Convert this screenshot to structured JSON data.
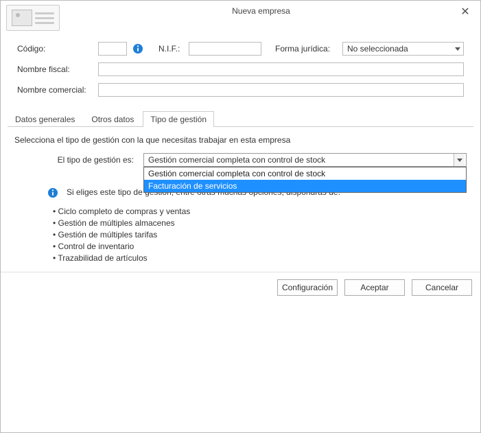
{
  "window": {
    "title": "Nueva empresa"
  },
  "header": {
    "codigo_label": "Código:",
    "codigo_value": "",
    "nif_label": "N.I.F.:",
    "nif_value": "",
    "forma_label": "Forma jurídica:",
    "forma_value": "No seleccionada",
    "nombre_fiscal_label": "Nombre fiscal:",
    "nombre_fiscal_value": "",
    "nombre_comercial_label": "Nombre comercial:",
    "nombre_comercial_value": ""
  },
  "tabs": {
    "t0": "Datos generales",
    "t1": "Otros datos",
    "t2": "Tipo de gestión"
  },
  "panel": {
    "intro": "Selecciona el tipo de gestión con la que necesitas trabajar en esta empresa",
    "tipo_label": "El tipo de gestión es:",
    "tipo_value": "Gestión comercial completa con control de stock",
    "options": {
      "o0": "Gestión comercial completa con control de stock",
      "o1": "Facturación de servicios"
    },
    "desc_intro": "Si eliges este tipo de gestión, entre otras muchas opciones, dispondrás de:",
    "bullets": {
      "b0": "Ciclo completo de compras y ventas",
      "b1": "Gestión de múltiples almacenes",
      "b2": "Gestión de múltiples tarifas",
      "b3": "Control de inventario",
      "b4": "Trazabilidad de artículos"
    }
  },
  "footer": {
    "configuracion": "Configuración",
    "aceptar": "Aceptar",
    "cancelar": "Cancelar"
  }
}
